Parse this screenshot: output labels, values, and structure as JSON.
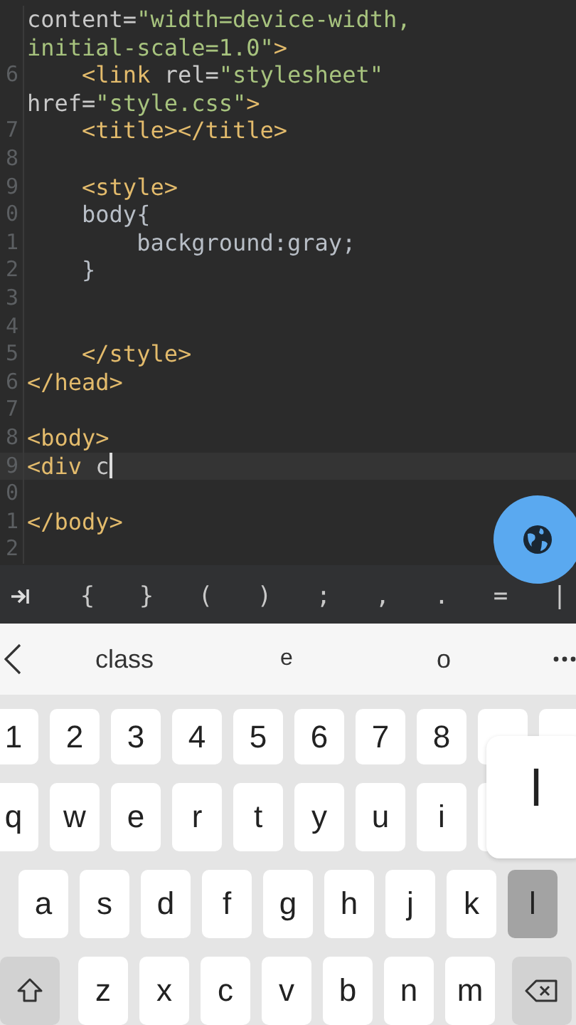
{
  "editor": {
    "lines": [
      {
        "current": false,
        "segments": [
          {
            "kind": "attr",
            "text": "content="
          },
          {
            "kind": "str",
            "text": "\"width=device-width,"
          }
        ]
      },
      {
        "current": false,
        "segments": [
          {
            "kind": "str",
            "text": "initial-scale=1.0\""
          },
          {
            "kind": "tag",
            "text": ">"
          }
        ]
      },
      {
        "number": "6",
        "current": false,
        "segments": [
          {
            "kind": "tag",
            "text": "    <link"
          },
          {
            "kind": "attr",
            "text": " rel="
          },
          {
            "kind": "str",
            "text": "\"stylesheet\""
          }
        ]
      },
      {
        "current": false,
        "segments": [
          {
            "kind": "attr",
            "text": "href="
          },
          {
            "kind": "str",
            "text": "\"style.css\""
          },
          {
            "kind": "tag",
            "text": ">"
          }
        ]
      },
      {
        "number": "7",
        "current": false,
        "segments": [
          {
            "kind": "tag",
            "text": "    <title></title>"
          }
        ]
      },
      {
        "number": "8",
        "current": false
      },
      {
        "number": "9",
        "current": false,
        "segments": [
          {
            "kind": "tag",
            "text": "    <style>"
          }
        ]
      },
      {
        "number": "0",
        "current": false,
        "segments": [
          {
            "kind": "css",
            "text": "    body{"
          }
        ]
      },
      {
        "number": "1",
        "current": false,
        "segments": [
          {
            "kind": "css",
            "text": "        background:gray;"
          }
        ]
      },
      {
        "number": "2",
        "current": false,
        "segments": [
          {
            "kind": "css",
            "text": "    }"
          }
        ]
      },
      {
        "number": "3",
        "current": false
      },
      {
        "number": "4",
        "current": false
      },
      {
        "number": "5",
        "current": false,
        "segments": [
          {
            "kind": "tag",
            "text": "    </style>"
          }
        ]
      },
      {
        "number": "6",
        "current": false,
        "segments": [
          {
            "kind": "tag",
            "text": "</head>"
          }
        ]
      },
      {
        "number": "7",
        "current": false
      },
      {
        "number": "8",
        "current": false,
        "segments": [
          {
            "kind": "tag",
            "text": "<body>"
          }
        ]
      },
      {
        "number": "9",
        "current": true,
        "segments": [
          {
            "kind": "tag",
            "text": "<div"
          },
          {
            "kind": "attr",
            "text": " c"
          }
        ]
      },
      {
        "number": "0",
        "current": false
      },
      {
        "number": "1",
        "current": false,
        "segments": [
          {
            "kind": "tag",
            "text": "</body>"
          }
        ]
      },
      {
        "number": "2",
        "current": false
      }
    ]
  },
  "symbol_bar": {
    "keys": [
      "{",
      "}",
      "(",
      ")",
      ";",
      ",",
      ".",
      "=",
      "|"
    ]
  },
  "suggestions": [
    "class",
    "e",
    "o"
  ],
  "keyboard": {
    "rows": [
      {
        "keys": [
          {
            "kind": "char",
            "label": "1",
            "pressed": false
          },
          {
            "kind": "char",
            "label": "2",
            "pressed": false
          },
          {
            "kind": "char",
            "label": "3",
            "pressed": false
          },
          {
            "kind": "char",
            "label": "4",
            "pressed": false
          },
          {
            "kind": "char",
            "label": "5",
            "pressed": false
          },
          {
            "kind": "char",
            "label": "6",
            "pressed": false
          },
          {
            "kind": "char",
            "label": "7",
            "pressed": false
          },
          {
            "kind": "char",
            "label": "8",
            "pressed": false
          },
          {
            "kind": "blank"
          },
          {
            "kind": "blank"
          }
        ]
      },
      {
        "keys": [
          {
            "kind": "char",
            "label": "q",
            "pressed": false
          },
          {
            "kind": "char",
            "label": "w",
            "pressed": false
          },
          {
            "kind": "char",
            "label": "e",
            "pressed": false
          },
          {
            "kind": "char",
            "label": "r",
            "pressed": false
          },
          {
            "kind": "char",
            "label": "t",
            "pressed": false
          },
          {
            "kind": "char",
            "label": "y",
            "pressed": false
          },
          {
            "kind": "char",
            "label": "u",
            "pressed": false
          },
          {
            "kind": "char",
            "label": "i",
            "pressed": false
          },
          {
            "kind": "blank"
          }
        ]
      },
      {
        "keys": [
          {
            "kind": "char",
            "label": "a",
            "pressed": false
          },
          {
            "kind": "char",
            "label": "s",
            "pressed": false
          },
          {
            "kind": "char",
            "label": "d",
            "pressed": false
          },
          {
            "kind": "char",
            "label": "f",
            "pressed": false
          },
          {
            "kind": "char",
            "label": "g",
            "pressed": false
          },
          {
            "kind": "char",
            "label": "h",
            "pressed": false
          },
          {
            "kind": "char",
            "label": "j",
            "pressed": false
          },
          {
            "kind": "char",
            "label": "k",
            "pressed": false
          },
          {
            "kind": "char",
            "label": "l",
            "pressed": true
          }
        ]
      },
      {
        "keys": [
          {
            "kind": "shift"
          },
          {
            "kind": "char",
            "label": "z",
            "pressed": false
          },
          {
            "kind": "char",
            "label": "x",
            "pressed": false
          },
          {
            "kind": "char",
            "label": "c",
            "pressed": false
          },
          {
            "kind": "char",
            "label": "v",
            "pressed": false
          },
          {
            "kind": "char",
            "label": "b",
            "pressed": false
          },
          {
            "kind": "char",
            "label": "n",
            "pressed": false
          },
          {
            "kind": "char",
            "label": "m",
            "pressed": false
          },
          {
            "kind": "backspace"
          }
        ]
      }
    ]
  },
  "key_preview": {
    "label": "l"
  }
}
